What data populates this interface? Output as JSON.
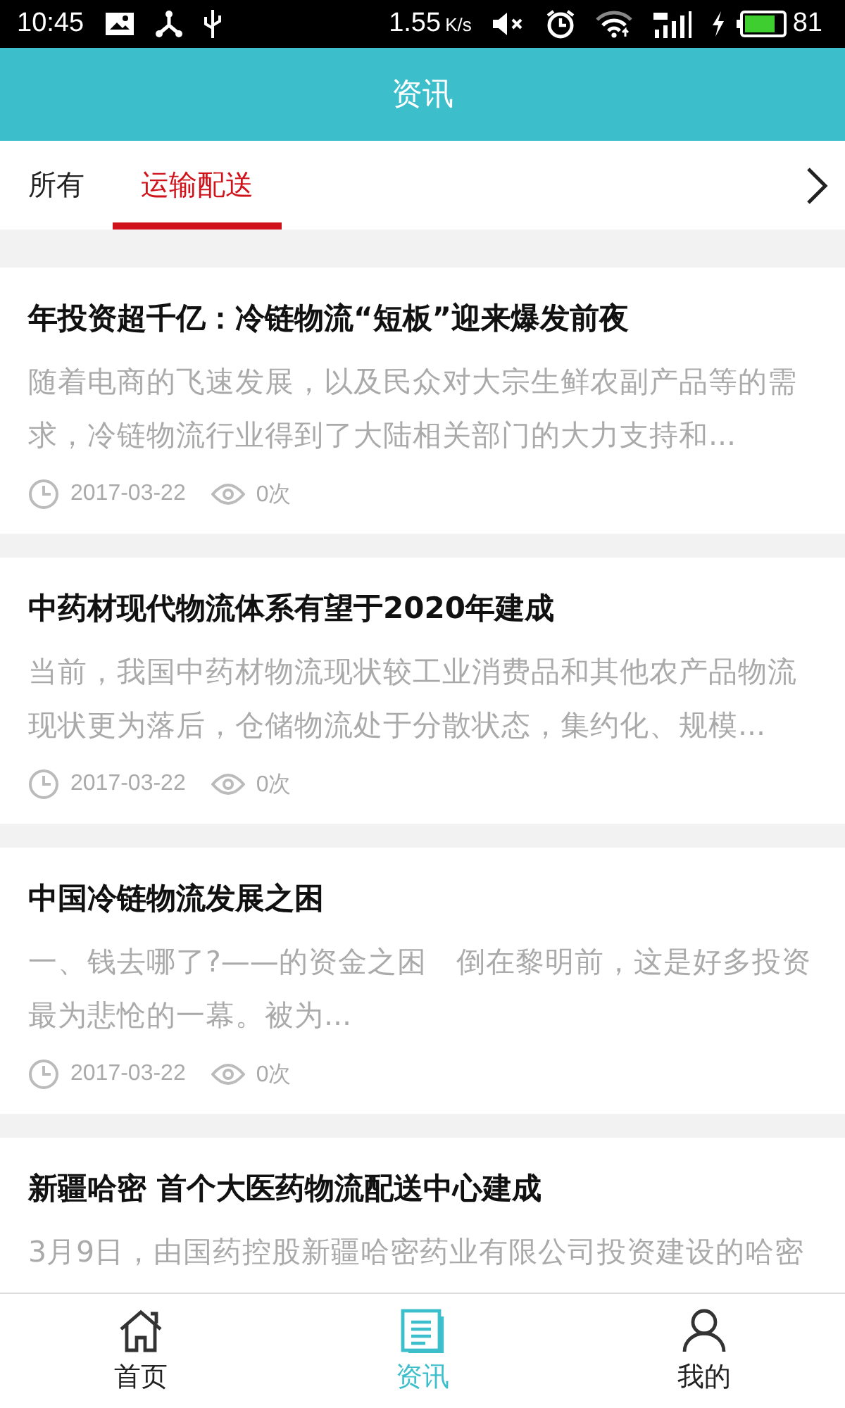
{
  "status_bar": {
    "time": "10:45",
    "speed": "1.55",
    "speed_unit": "K/s",
    "battery": "81"
  },
  "header": {
    "title": "资讯"
  },
  "tabs": [
    {
      "label": "所有",
      "selected": false
    },
    {
      "label": "运输配送",
      "selected": true
    }
  ],
  "articles": [
    {
      "title": "年投资超千亿：冷链物流“短板”迎来爆发前夜",
      "summary": "随着电商的飞速发展，以及民众对大宗生鲜农副产品等的需求，冷链物流行业得到了大陆相关部门的大力支持和...",
      "date": "2017-03-22",
      "views": "0次"
    },
    {
      "title": "中药材现代物流体系有望于2020年建成",
      "summary": "当前，我国中药材物流现状较工业消费品和其他农产品物流现状更为落后，仓储物流处于分散状态，集约化、规模...",
      "date": "2017-03-22",
      "views": "0次"
    },
    {
      "title": "中国冷链物流发展之困",
      "summary": "一、钱去哪了?——的资金之困　倒在黎明前，这是好多投资最为悲怆的一幕。被为...",
      "date": "2017-03-22",
      "views": "0次"
    },
    {
      "title": "新疆哈密 首个大医药物流配送中心建成",
      "summary": "3月9日，由国药控股新疆哈密药业有限公司投资建设的哈密"
    }
  ],
  "bottom_nav": [
    {
      "kind": "home",
      "label": "首页",
      "selected": false
    },
    {
      "kind": "news",
      "label": "资讯",
      "selected": true
    },
    {
      "kind": "profile",
      "label": "我的",
      "selected": false
    }
  ]
}
